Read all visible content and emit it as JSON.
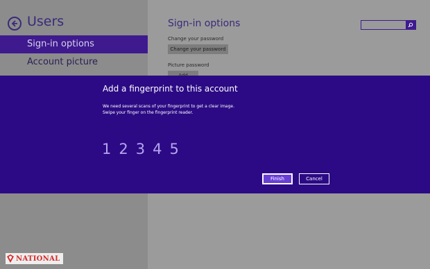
{
  "left_panel": {
    "title": "Users",
    "nav_items": [
      {
        "label": "Sign-in options",
        "selected": true
      },
      {
        "label": "Account picture",
        "selected": false
      }
    ]
  },
  "content": {
    "title": "Sign-in options",
    "change_password": {
      "label": "Change your password",
      "button": "Change your password"
    },
    "picture_password": {
      "label": "Picture password",
      "button": "Add"
    }
  },
  "search": {
    "placeholder": "",
    "icon": "search-icon"
  },
  "dialog": {
    "title": "Add a fingerprint to this account",
    "description_line1": "We need several scans of your fingerprint to get a clear image.",
    "description_line2": "Swipe your finger on the fingerprint reader.",
    "scan_steps": [
      "1",
      "2",
      "3",
      "4",
      "5"
    ],
    "finish_button": "Finish",
    "cancel_button": "Cancel"
  },
  "watermark": {
    "text": "NATIONAL"
  },
  "colors": {
    "accent": "#3e1a8e",
    "dialog_bg": "#2c0a85",
    "step_color": "#b5a4ee",
    "watermark_red": "#d82a2a"
  }
}
